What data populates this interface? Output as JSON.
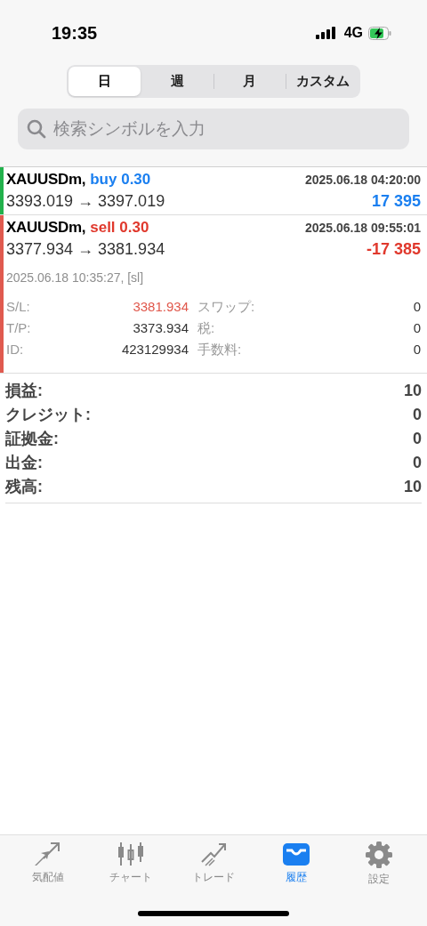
{
  "status_bar": {
    "time": "19:35",
    "network": "4G"
  },
  "period_tabs": [
    {
      "label": "日",
      "selected": true
    },
    {
      "label": "週",
      "selected": false
    },
    {
      "label": "月",
      "selected": false
    },
    {
      "label": "カスタム",
      "selected": false
    }
  ],
  "search": {
    "placeholder": "検索シンボルを入力"
  },
  "deals": [
    {
      "symbol": "XAUUSDm,",
      "kind": "buy",
      "volume_text": "buy 0.30",
      "time": "2025.06.18 04:20:00",
      "prices": "3393.019 → 3397.019",
      "profit": "17 395",
      "color": "#22b14c",
      "expanded": false
    },
    {
      "symbol": "XAUUSDm,",
      "kind": "sell",
      "volume_text": "sell 0.30",
      "time": "2025.06.18 09:55:01",
      "prices": "3377.934 → 3381.934",
      "profit": "-17 385",
      "color": "#e05a4f",
      "expanded": true,
      "close_info": "2025.06.18 10:35:27, [sl]",
      "details": [
        {
          "label": "S/L:",
          "value": "3381.934",
          "highlight": true,
          "label2": "スワップ:",
          "value2": "0"
        },
        {
          "label": "T/P:",
          "value": "3373.934",
          "highlight": false,
          "label2": "税:",
          "value2": "0"
        },
        {
          "label": "ID:",
          "value": "423129934",
          "highlight": false,
          "label2": "手数料:",
          "value2": "0"
        }
      ]
    }
  ],
  "summary": [
    {
      "label": "損益:",
      "value": "10"
    },
    {
      "label": "クレジット:",
      "value": "0"
    },
    {
      "label": "証拠金:",
      "value": "0"
    },
    {
      "label": "出金:",
      "value": "0"
    },
    {
      "label": "残高:",
      "value": "10"
    }
  ],
  "tab_bar": [
    {
      "label": "気配値",
      "selected": false
    },
    {
      "label": "チャート",
      "selected": false
    },
    {
      "label": "トレード",
      "selected": false
    },
    {
      "label": "履歴",
      "selected": true
    },
    {
      "label": "設定",
      "selected": false
    }
  ]
}
